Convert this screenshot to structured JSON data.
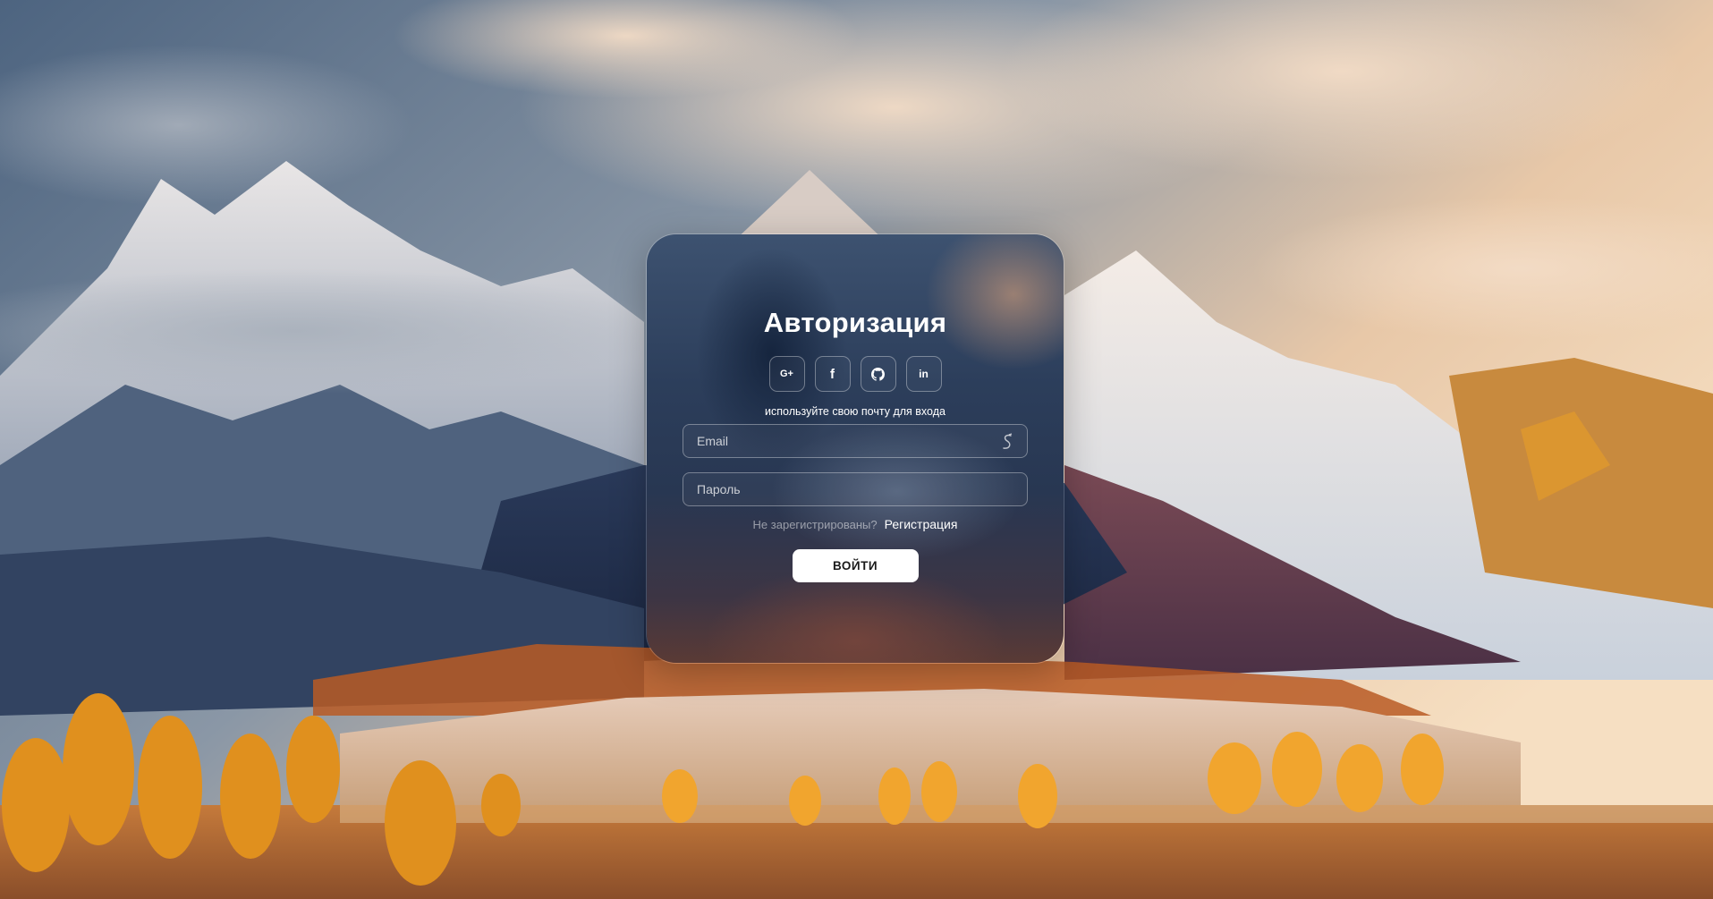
{
  "auth": {
    "title": "Авторизация",
    "socials": [
      {
        "icon": "google-plus-icon",
        "glyph": "G+"
      },
      {
        "icon": "facebook-icon",
        "glyph": "f"
      },
      {
        "icon": "github-icon",
        "glyph": ""
      },
      {
        "icon": "linkedin-icon",
        "glyph": "in"
      }
    ],
    "hint": "используйте свою почту для входа",
    "email": {
      "placeholder": "Email",
      "value": ""
    },
    "password": {
      "placeholder": "Пароль",
      "value": ""
    },
    "register_question": "Не зарегистрированы?",
    "register_link": "Регистрация",
    "login_label": "ВОЙТИ"
  },
  "colors": {
    "card_text": "#ffffff",
    "button_bg": "#ffffff",
    "button_text": "#1a1a1a"
  }
}
